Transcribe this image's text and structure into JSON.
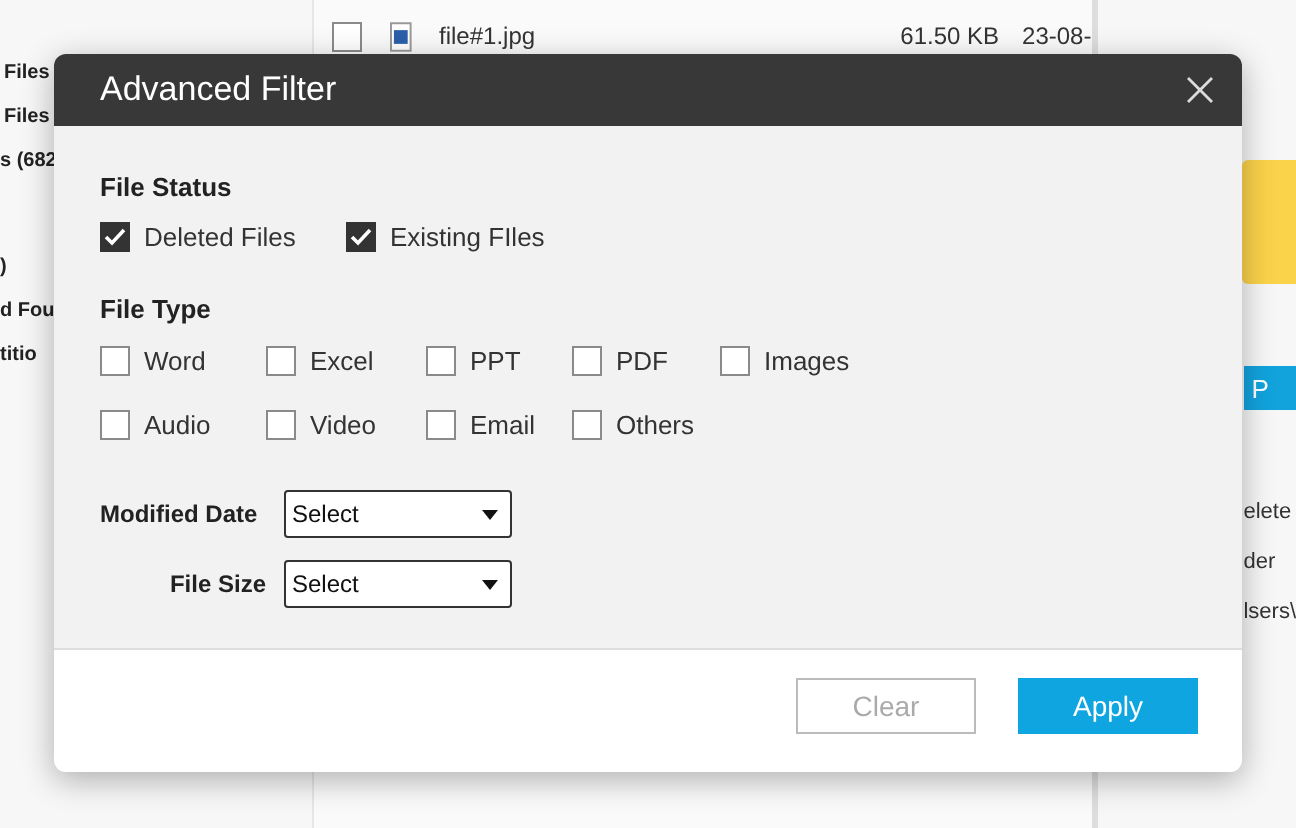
{
  "background": {
    "sidebar_items": [
      "Files",
      "Files",
      "s (682",
      ")",
      "d Fou",
      "titio"
    ],
    "file_rows": [
      {
        "name": "file#1.jpg",
        "size": "61.50 KB",
        "date": "23-08-",
        "checked": false
      }
    ],
    "right_button": "P",
    "right_lines": [
      "elete",
      "der",
      "lsers\\"
    ]
  },
  "dialog": {
    "title": "Advanced Filter",
    "file_status": {
      "heading": "File Status",
      "options": [
        {
          "label": "Deleted Files",
          "checked": true
        },
        {
          "label": "Existing FIles",
          "checked": true
        }
      ]
    },
    "file_type": {
      "heading": "File Type",
      "rows": [
        [
          {
            "label": "Word",
            "checked": false
          },
          {
            "label": "Excel",
            "checked": false
          },
          {
            "label": "PPT",
            "checked": false
          },
          {
            "label": "PDF",
            "checked": false
          },
          {
            "label": "Images",
            "checked": false
          }
        ],
        [
          {
            "label": "Audio",
            "checked": false
          },
          {
            "label": "Video",
            "checked": false
          },
          {
            "label": "Email",
            "checked": false
          },
          {
            "label": "Others",
            "checked": false
          }
        ]
      ]
    },
    "filters": [
      {
        "label": "Modified Date",
        "value": "Select"
      },
      {
        "label": "File Size",
        "value": "Select"
      }
    ],
    "buttons": [
      {
        "label": "Clear",
        "kind": "secondary",
        "disabled": true
      },
      {
        "label": "Apply",
        "kind": "primary",
        "disabled": false
      }
    ]
  }
}
